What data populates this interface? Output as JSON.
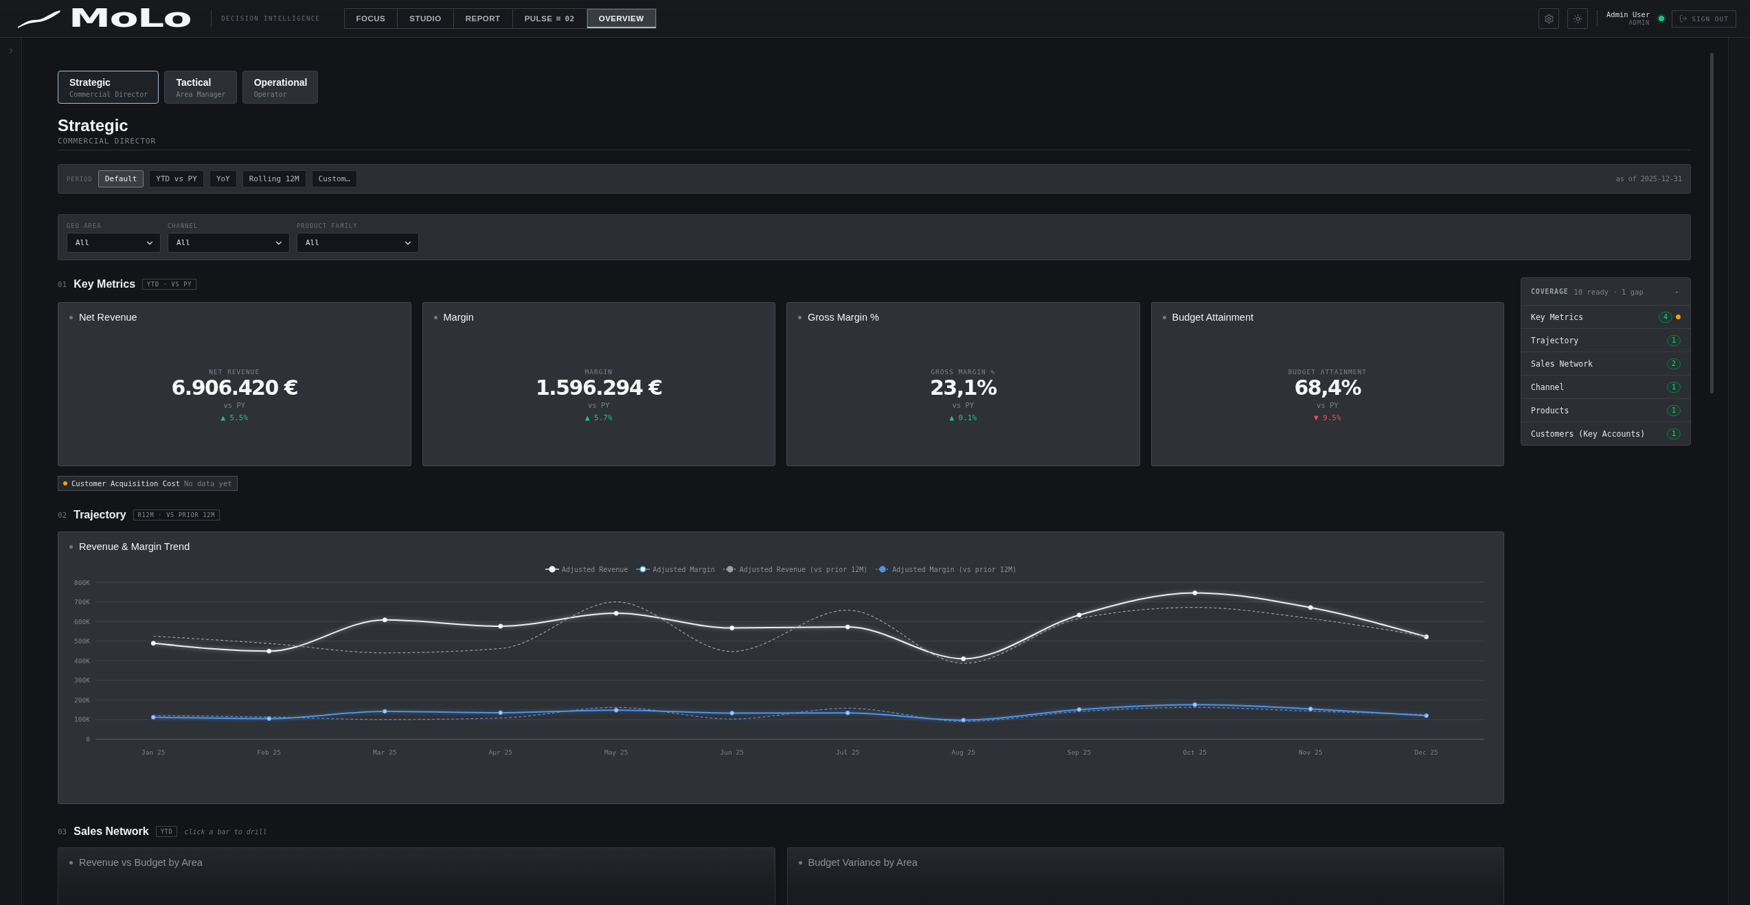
{
  "header": {
    "logo": "MoLo",
    "tagline": "DECISION INTELLIGENCE",
    "nav": [
      {
        "label": "FOCUS",
        "selected": false
      },
      {
        "label": "STUDIO",
        "selected": false
      },
      {
        "label": "REPORT",
        "selected": false
      },
      {
        "label": "PULSE",
        "count": "02",
        "selected": false
      },
      {
        "label": "OVERVIEW",
        "selected": true
      }
    ],
    "user": {
      "name": "Admin User",
      "role": "ADMIN",
      "online": true
    },
    "sign_out": "SIGN OUT"
  },
  "personas": [
    {
      "title": "Strategic",
      "subtitle": "Commercial Director",
      "selected": true
    },
    {
      "title": "Tactical",
      "subtitle": "Area Manager",
      "selected": false
    },
    {
      "title": "Operational",
      "subtitle": "Operator",
      "selected": false
    }
  ],
  "page": {
    "title": "Strategic",
    "subtitle": "COMMERCIAL DIRECTOR"
  },
  "period": {
    "label": "PERIOD",
    "options": [
      {
        "label": "Default",
        "selected": true
      },
      {
        "label": "YTD vs PY",
        "selected": false
      },
      {
        "label": "YoY",
        "selected": false
      },
      {
        "label": "Rolling 12M",
        "selected": false
      },
      {
        "label": "Custom…",
        "selected": false
      }
    ],
    "as_of": "as of 2025-12-31"
  },
  "filters": [
    {
      "label": "GEO AREA",
      "value": "All"
    },
    {
      "label": "CHANNEL",
      "value": "All"
    },
    {
      "label": "PRODUCT FAMILY",
      "value": "All"
    }
  ],
  "key_metrics": {
    "number": "01",
    "title": "Key Metrics",
    "badge": "YTD · VS PY",
    "cards": [
      {
        "title": "Net Revenue",
        "label": "NET REVENUE",
        "value": "6.906.420 €",
        "comparison": "vs PY",
        "delta": "▲ 5.5%",
        "color": "#22c38e"
      },
      {
        "title": "Margin",
        "label": "MARGIN",
        "value": "1.596.294 €",
        "comparison": "vs PY",
        "delta": "▲ 5.7%",
        "color": "#22c38e"
      },
      {
        "title": "Gross Margin %",
        "label": "GROSS MARGIN %",
        "value": "23,1%",
        "comparison": "vs PY",
        "delta": "▲ 0.1%",
        "color": "#22c38e"
      },
      {
        "title": "Budget Attainment",
        "label": "BUDGET ATTAINMENT",
        "value": "68,4%",
        "comparison": "vs PY",
        "delta": "▼ 9.5%",
        "color": "#ef4f5a"
      }
    ],
    "missing": [
      {
        "name": "Customer Acquisition Cost",
        "status": "No data yet"
      }
    ]
  },
  "trajectory": {
    "number": "02",
    "title": "Trajectory",
    "badge": "R12M · VS PRIOR 12M",
    "card": {
      "title": "Revenue & Margin Trend",
      "chart_data": {
        "type": "line",
        "grid": true,
        "categories": [
          "Jan 25",
          "Feb 25",
          "Mar 25",
          "Apr 25",
          "May 25",
          "Jun 25",
          "Jul 25",
          "Aug 25",
          "Sep 25",
          "Oct 25",
          "Nov 25",
          "Dec 25"
        ],
        "series": [
          {
            "name": "Adjusted Revenue",
            "color": "#eef0f2",
            "line_style": "solid",
            "marker": "circle",
            "values": [
              489000,
              449000,
              608000,
              576000,
              642000,
              567000,
              572000,
              410000,
              633000,
              746000,
              671000,
              522000
            ]
          },
          {
            "name": "Adjusted Margin",
            "color": "#4f94ea",
            "line_style": "solid",
            "marker": "circle",
            "values": [
              112000,
              105000,
              142000,
              135000,
              148000,
              133000,
              134000,
              97000,
              151000,
              176000,
              154000,
              120000
            ]
          },
          {
            "name": "Adjusted Revenue (vs prior 12M)",
            "color": "#9b9fa4",
            "line_style": "dashed",
            "values": [
              525000,
              488000,
              440000,
              462000,
              700000,
              447000,
              658000,
              387000,
              615000,
              672000,
              615000,
              524000
            ]
          },
          {
            "name": "Adjusted Margin (vs prior 12M)",
            "color": "#5b8ed8",
            "line_style": "dashed",
            "values": [
              120000,
              113000,
              100000,
              108000,
              162000,
              103000,
              158000,
              91000,
              141000,
              162000,
              143000,
              125000
            ]
          }
        ],
        "ylim": [
          0,
          800000
        ],
        "yticks": [
          {
            "value": 0,
            "label": "0"
          },
          {
            "value": 100000,
            "label": "100K"
          },
          {
            "value": 200000,
            "label": "200K"
          },
          {
            "value": 300000,
            "label": "300K"
          },
          {
            "value": 400000,
            "label": "400K"
          },
          {
            "value": 500000,
            "label": "500K"
          },
          {
            "value": 600000,
            "label": "600K"
          },
          {
            "value": 700000,
            "label": "700K"
          },
          {
            "value": 800000,
            "label": "800K"
          }
        ]
      }
    }
  },
  "sales_network": {
    "number": "03",
    "title": "Sales Network",
    "badge": "YTD",
    "hint": "click a bar to drill",
    "cards": [
      {
        "title": "Revenue vs Budget by Area"
      },
      {
        "title": "Budget Variance by Area"
      }
    ]
  },
  "coverage": {
    "label": "COVERAGE",
    "summary": "10 ready · 1 gap",
    "toggle": "-",
    "items": [
      {
        "name": "Key Metrics",
        "count": "4",
        "gap": true
      },
      {
        "name": "Trajectory",
        "count": "1",
        "gap": false
      },
      {
        "name": "Sales Network",
        "count": "2",
        "gap": false
      },
      {
        "name": "Channel",
        "count": "1",
        "gap": false
      },
      {
        "name": "Products",
        "count": "1",
        "gap": false
      },
      {
        "name": "Customers (Key Accounts)",
        "count": "1",
        "gap": false
      }
    ]
  }
}
